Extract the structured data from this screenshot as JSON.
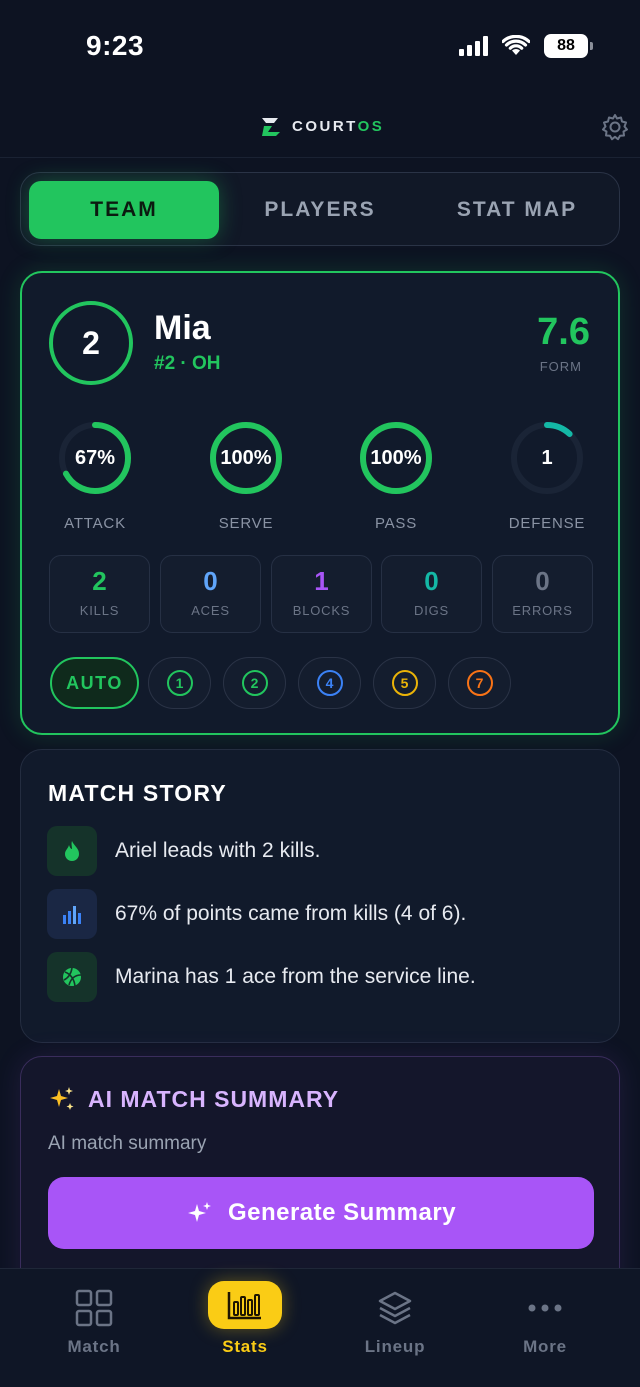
{
  "status_bar": {
    "time": "9:23",
    "battery": "88"
  },
  "header": {
    "brand_prefix": "COURT",
    "brand_suffix": "OS"
  },
  "tabs": [
    {
      "label": "TEAM",
      "active": true
    },
    {
      "label": "PLAYERS",
      "active": false
    },
    {
      "label": "STAT MAP",
      "active": false
    }
  ],
  "player": {
    "number": "2",
    "name": "Mia",
    "role": "#2 · OH",
    "form_value": "7.6",
    "form_label": "FORM",
    "rings": [
      {
        "value": "67%",
        "label": "ATTACK",
        "fraction": 0.67,
        "color": "#22c55e"
      },
      {
        "value": "100%",
        "label": "SERVE",
        "fraction": 1.0,
        "color": "#22c55e"
      },
      {
        "value": "100%",
        "label": "PASS",
        "fraction": 1.0,
        "color": "#22c55e"
      },
      {
        "value": "1",
        "label": "DEFENSE",
        "fraction": 0.12,
        "color": "#14b8a6"
      }
    ],
    "stats": [
      {
        "value": "2",
        "label": "KILLS",
        "color": "#22c55e"
      },
      {
        "value": "0",
        "label": "ACES",
        "color": "#60a5fa"
      },
      {
        "value": "1",
        "label": "BLOCKS",
        "color": "#a855f7"
      },
      {
        "value": "0",
        "label": "DIGS",
        "color": "#14b8a6"
      },
      {
        "value": "0",
        "label": "ERRORS",
        "color": "#6b7486"
      }
    ],
    "rotation": {
      "auto_label": "AUTO",
      "chips": [
        {
          "value": "1",
          "color": "#22c55e"
        },
        {
          "value": "2",
          "color": "#22c55e"
        },
        {
          "value": "4",
          "color": "#3b82f6"
        },
        {
          "value": "5",
          "color": "#eab308"
        },
        {
          "value": "7",
          "color": "#f97316"
        }
      ]
    }
  },
  "match_story": {
    "title": "MATCH STORY",
    "items": [
      {
        "icon": "flame-icon",
        "text": "Ariel leads with 2 kills."
      },
      {
        "icon": "bar-chart-icon",
        "text": "67% of points came from kills (4 of 6)."
      },
      {
        "icon": "volleyball-icon",
        "text": "Marina has 1 ace from the service line."
      }
    ]
  },
  "ai_summary": {
    "title": "AI MATCH SUMMARY",
    "subtitle": "AI match summary",
    "button_label": "Generate Summary"
  },
  "bottom_nav": [
    {
      "label": "Match",
      "icon": "grid-icon",
      "active": false
    },
    {
      "label": "Stats",
      "icon": "stats-icon",
      "active": true
    },
    {
      "label": "Lineup",
      "icon": "layers-icon",
      "active": false
    },
    {
      "label": "More",
      "icon": "more-icon",
      "active": false
    }
  ],
  "colors": {
    "accent_green": "#22c55e",
    "accent_purple": "#a855f7",
    "accent_yellow": "#facc15",
    "background": "#0d1322"
  }
}
